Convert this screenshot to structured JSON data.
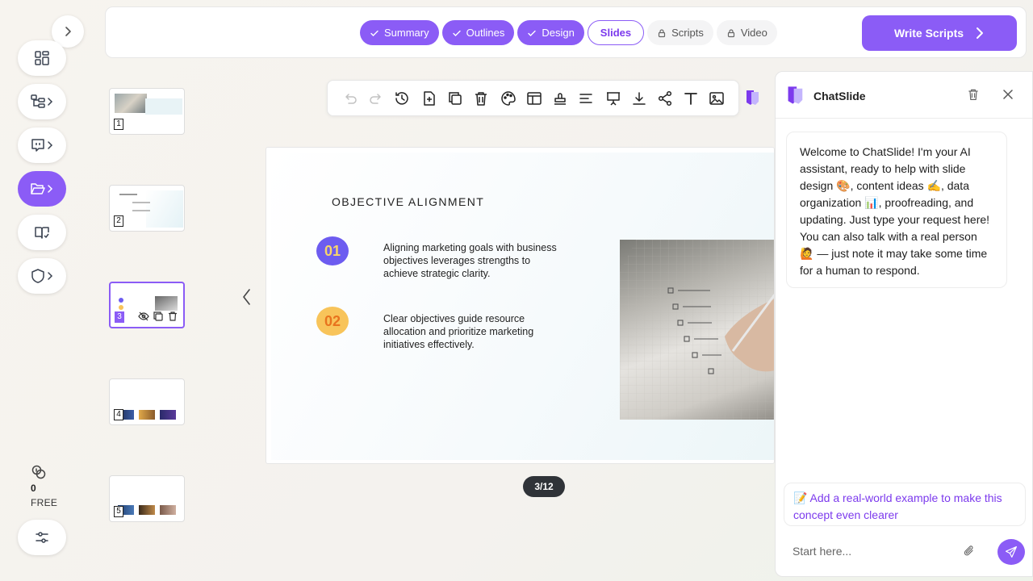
{
  "steps": [
    {
      "label": "Summary",
      "state": "done"
    },
    {
      "label": "Outlines",
      "state": "done"
    },
    {
      "label": "Design",
      "state": "done"
    },
    {
      "label": "Slides",
      "state": "current"
    },
    {
      "label": "Scripts",
      "state": "locked"
    },
    {
      "label": "Video",
      "state": "locked"
    }
  ],
  "header": {
    "write_scripts_label": "Write Scripts"
  },
  "credits": {
    "count": "0",
    "plan": "FREE"
  },
  "thumbnails": [
    "1",
    "2",
    "3",
    "4",
    "5"
  ],
  "slide": {
    "title": "OBJECTIVE ALIGNMENT",
    "items": [
      {
        "number": "01",
        "text": "Aligning marketing goals with business objectives leverages strengths to achieve strategic clarity."
      },
      {
        "number": "02",
        "text": "Clear objectives guide resource allocation and prioritize marketing initiatives effectively."
      }
    ],
    "page_indicator": "3/12"
  },
  "chat": {
    "title": "ChatSlide",
    "welcome": "Welcome to ChatSlide! I'm your AI assistant, ready to help with slide design 🎨, content ideas ✍️, data organization 📊, proofreading, and updating. Just type your request here! You can also talk with a real person 🙋 — just note it may take some time for a human to respond.",
    "suggestion": "📝 Add a real-world example to make this concept even clearer",
    "input_placeholder": "Start here..."
  },
  "colors": {
    "accent": "#8b5cf6",
    "circle_1": "#6d5cf0",
    "circle_2": "#f8c45a",
    "circle_2_text": "#e8731e"
  }
}
